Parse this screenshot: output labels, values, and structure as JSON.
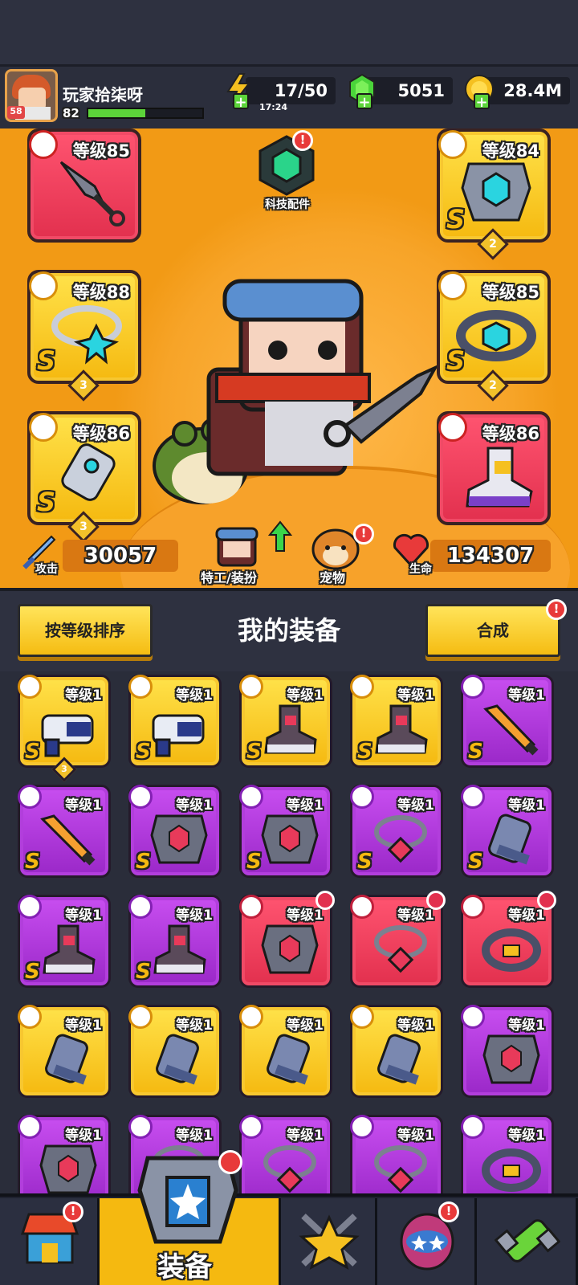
{
  "player": {
    "name": "玩家拾柒呀",
    "avatar_level": "58",
    "level": "82",
    "xp_fraction": 0.5
  },
  "resources": {
    "energy": "17/50",
    "energy_timer": "17:24",
    "gems": "5051",
    "gold": "28.4M"
  },
  "equipped": {
    "weapon": {
      "level": "等级85",
      "rarity_color": "red"
    },
    "armor": {
      "level": "等级84",
      "grade": "S",
      "stars": "2",
      "rarity_color": "yellow"
    },
    "necklace": {
      "level": "等级88",
      "grade": "S",
      "stars": "3",
      "rarity_color": "yellow"
    },
    "belt": {
      "level": "等级85",
      "grade": "S",
      "stars": "2",
      "rarity_color": "yellow"
    },
    "gloves": {
      "level": "等级86",
      "grade": "S",
      "stars": "3",
      "rarity_color": "yellow"
    },
    "boots": {
      "level": "等级86",
      "rarity_color": "red"
    }
  },
  "tech_parts": {
    "label": "科技配件",
    "badge": "!"
  },
  "stats": {
    "attack_label": "攻击",
    "attack": "30057",
    "hp_label": "生命",
    "hp": "134307"
  },
  "agent_label": "特工/装扮",
  "pet_label": "宠物",
  "inventory": {
    "sort_label": "按等级排序",
    "title": "我的装备",
    "combine_label": "合成",
    "items": [
      {
        "level": "等级1",
        "grade": "S",
        "stars": "3",
        "color": "yellow",
        "kind": "weapon-gun"
      },
      {
        "level": "等级1",
        "grade": "S",
        "color": "yellow",
        "kind": "weapon-gun"
      },
      {
        "level": "等级1",
        "grade": "S",
        "color": "yellow",
        "kind": "boots"
      },
      {
        "level": "等级1",
        "grade": "S",
        "color": "yellow",
        "kind": "boots"
      },
      {
        "level": "等级1",
        "grade": "S",
        "color": "purple",
        "kind": "weapon-sword"
      },
      {
        "level": "等级1",
        "grade": "S",
        "color": "purple",
        "kind": "weapon-sword"
      },
      {
        "level": "等级1",
        "grade": "S",
        "color": "purple",
        "kind": "armor"
      },
      {
        "level": "等级1",
        "grade": "S",
        "color": "purple",
        "kind": "armor"
      },
      {
        "level": "等级1",
        "grade": "S",
        "color": "purple",
        "kind": "necklace"
      },
      {
        "level": "等级1",
        "grade": "S",
        "color": "purple",
        "kind": "gloves"
      },
      {
        "level": "等级1",
        "grade": "S",
        "color": "purple",
        "kind": "boots"
      },
      {
        "level": "等级1",
        "grade": "S",
        "color": "purple",
        "kind": "boots"
      },
      {
        "level": "等级1",
        "color": "red",
        "kind": "armor"
      },
      {
        "level": "等级1",
        "color": "red",
        "kind": "necklace"
      },
      {
        "level": "等级1",
        "color": "red",
        "kind": "belt"
      },
      {
        "level": "等级1",
        "color": "yellow",
        "kind": "gloves"
      },
      {
        "level": "等级1",
        "color": "yellow",
        "kind": "gloves"
      },
      {
        "level": "等级1",
        "color": "yellow",
        "kind": "gloves"
      },
      {
        "level": "等级1",
        "color": "yellow",
        "kind": "gloves"
      },
      {
        "level": "等级1",
        "color": "purple",
        "kind": "armor"
      },
      {
        "level": "等级1",
        "color": "purple",
        "kind": "armor"
      },
      {
        "level": "等级1",
        "color": "purple",
        "kind": "necklace"
      },
      {
        "level": "等级1",
        "color": "purple",
        "kind": "necklace"
      },
      {
        "level": "等级1",
        "color": "purple",
        "kind": "necklace"
      },
      {
        "level": "等级1",
        "color": "purple",
        "kind": "belt"
      }
    ]
  },
  "nav": {
    "equip_label": "装备",
    "shop_badge": "!",
    "egg_badge": "!"
  },
  "colors": {
    "accent_orange": "#f29a15",
    "yellow": "#f5b910",
    "purple": "#9a28c8",
    "red": "#e2304e",
    "dark": "#2a2d3a"
  }
}
